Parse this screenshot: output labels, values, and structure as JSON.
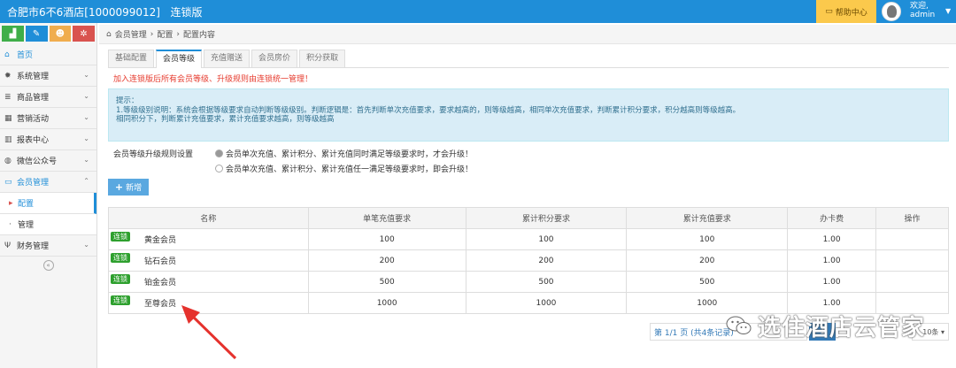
{
  "topbar": {
    "title": "合肥市6不6酒店[1000099012]",
    "edition": "连锁版",
    "help_label": "帮助中心",
    "user_welcome": "欢迎,",
    "user_name": "admin"
  },
  "sidebar": {
    "quick_buttons": [
      {
        "icon": "chart-icon",
        "color": "#3fae49"
      },
      {
        "icon": "pencil-icon",
        "color": "#1f8ed8"
      },
      {
        "icon": "users-icon",
        "color": "#f0ad4e"
      },
      {
        "icon": "cogs-icon",
        "color": "#d9534f"
      }
    ],
    "items": [
      {
        "label": "首页",
        "icon": "home-icon"
      },
      {
        "label": "系统管理",
        "icon": "gear-icon"
      },
      {
        "label": "商品管理",
        "icon": "database-icon"
      },
      {
        "label": "营销活动",
        "icon": "gift-icon"
      },
      {
        "label": "报表中心",
        "icon": "bar-chart-icon"
      },
      {
        "label": "微信公众号",
        "icon": "wechat-icon"
      },
      {
        "label": "会员管理",
        "icon": "member-card-icon"
      },
      {
        "label": "配置",
        "icon": "caret-right-icon"
      },
      {
        "label": "管理",
        "icon": "dot-icon"
      },
      {
        "label": "财务管理",
        "icon": "finance-icon"
      }
    ],
    "collapse_glyph": "«"
  },
  "breadcrumb": {
    "items": [
      "会员管理",
      "配置",
      "配置内容"
    ]
  },
  "tabs": [
    "基础配置",
    "会员等级",
    "充值赠送",
    "会员房价",
    "积分获取"
  ],
  "active_tab": "会员等级",
  "warning": "加入连锁版后所有会员等级、升级规则由连锁统一管理！",
  "tip": {
    "title": "提示：",
    "line1": "1.等级级别说明：系统会根据等级要求自动判断等级级别。判断逻辑是：首先判断单次充值要求，要求越高的，则等级越高，相同单次充值要求，判断累计积分要求，积分越高则等级越高。",
    "line2": "相同积分下，判断累计充值要求，累计充值要求越高，则等级越高"
  },
  "upgrade_rule": {
    "label": "会员等级升级规则设置",
    "options": [
      {
        "text": "会员单次充值、累计积分、累计充值同时满足等级要求时，才会升级！",
        "selected": true
      },
      {
        "text": "会员单次充值、累计积分、累计充值任一满足等级要求时，即会升级！",
        "selected": false
      }
    ]
  },
  "add_button": "新增",
  "table": {
    "headers": [
      "名称",
      "单笔充值要求",
      "累计积分要求",
      "累计充值要求",
      "办卡费",
      "操作"
    ],
    "tag_label": "连锁",
    "rows": [
      {
        "name": "黄金会员",
        "single": "100",
        "points": "100",
        "total": "100",
        "fee": "1.00",
        "ops": ""
      },
      {
        "name": "钻石会员",
        "single": "200",
        "points": "200",
        "total": "200",
        "fee": "1.00",
        "ops": ""
      },
      {
        "name": "铂金会员",
        "single": "500",
        "points": "500",
        "total": "500",
        "fee": "1.00",
        "ops": ""
      },
      {
        "name": "至尊会员",
        "single": "1000",
        "points": "1000",
        "total": "1000",
        "fee": "1.00",
        "ops": ""
      }
    ]
  },
  "pager": {
    "info": "第 1/1 页 (共4条记录)",
    "current": "1",
    "page_size": "10条"
  },
  "watermark": "选住酒店云管家",
  "colors": {
    "primary": "#1f8ed8",
    "help": "#fbc94c",
    "tag": "#2ea02e",
    "warning": "#e63b2e",
    "arrow": "#e5322d"
  }
}
